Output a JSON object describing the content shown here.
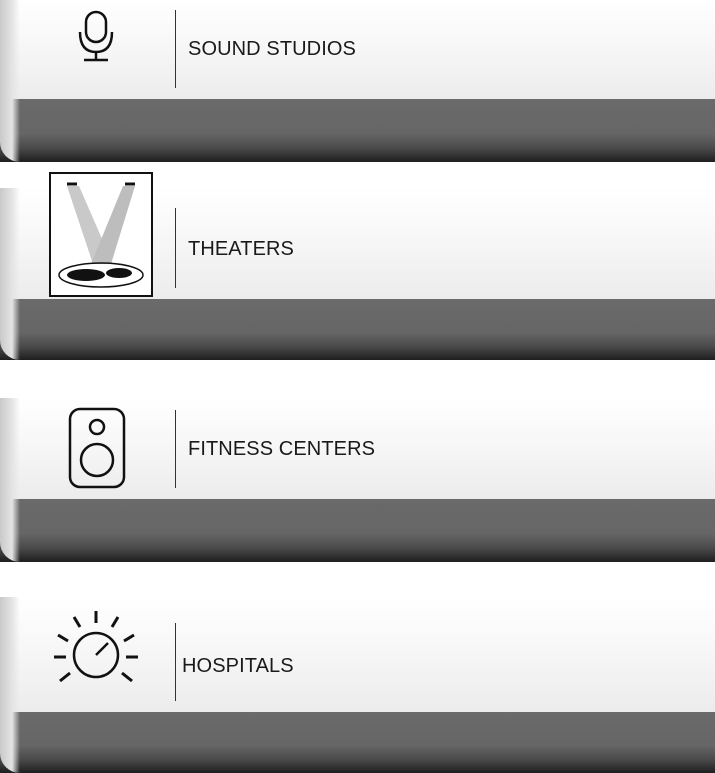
{
  "items": [
    {
      "label": "SOUND  STUDIOS",
      "icon": "microphone-icon"
    },
    {
      "label": "THEATERS",
      "icon": "spotlight-stage-icon"
    },
    {
      "label": "FITNESS CENTERS",
      "icon": "speaker-icon"
    },
    {
      "label": "HOSPITALS",
      "icon": "knob-dial-icon"
    }
  ],
  "colors": {
    "band": "#666666",
    "panel": "#f4f4f4",
    "text": "#1a1a1a"
  }
}
